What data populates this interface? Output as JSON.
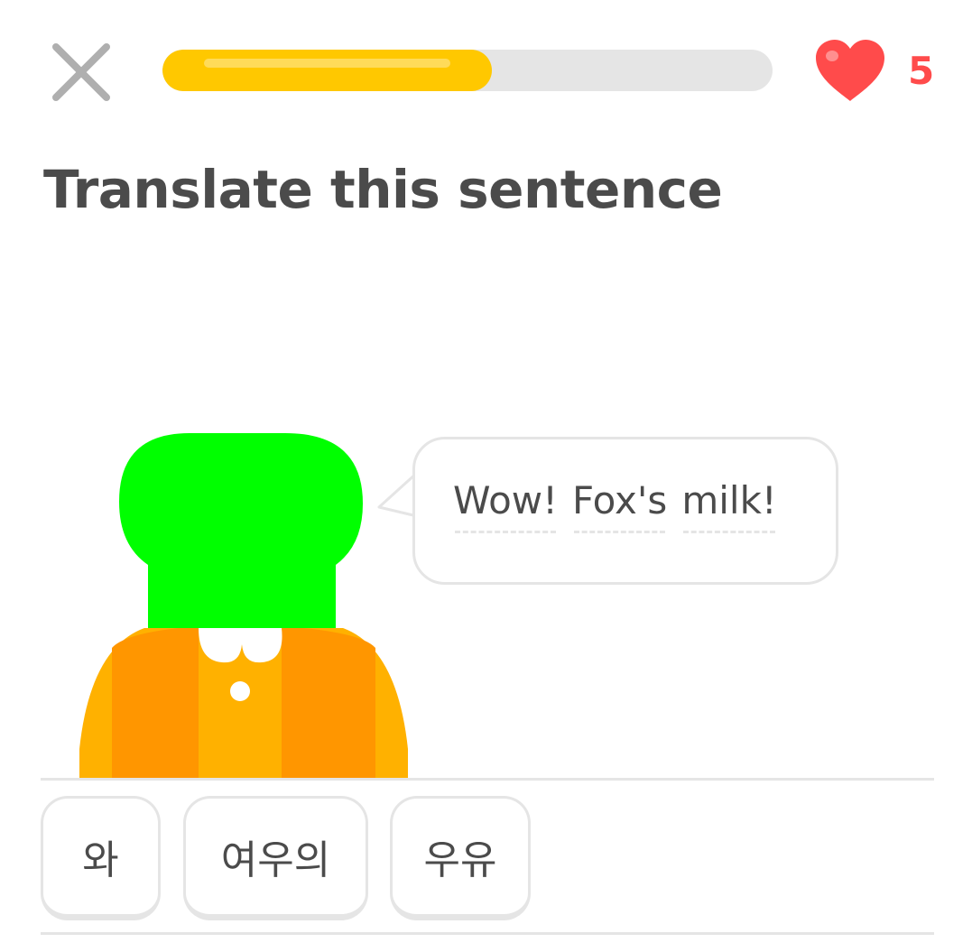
{
  "header": {
    "close_icon": "close-icon",
    "progress_fraction": 0.54,
    "progress_color": "#ffc800",
    "track_color": "#e5e5e5",
    "heart_icon": "heart-icon",
    "hearts_count": "5",
    "hearts_color": "#ff4b4b"
  },
  "prompt": {
    "title": "Translate this sentence"
  },
  "bubble": {
    "words": [
      "Wow!",
      "Fox's",
      "milk!"
    ]
  },
  "word_bank": {
    "tiles": [
      "와",
      "여우의",
      "우유"
    ]
  }
}
